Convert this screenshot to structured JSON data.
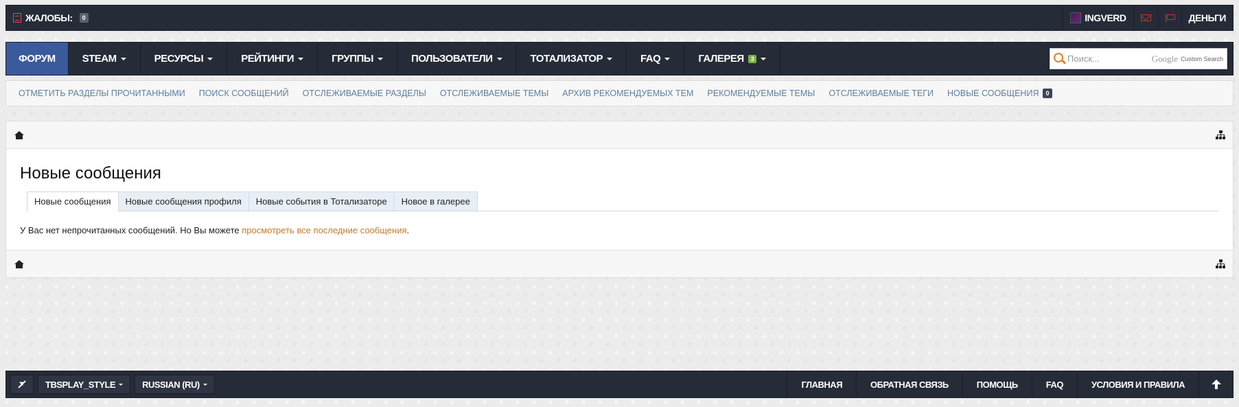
{
  "topbar": {
    "complaints_label": "Жалобы:",
    "complaints_count": "0",
    "username": "Ingverd",
    "money_label": "Деньги",
    "icons": [
      "complaints-icon",
      "avatar",
      "envelope-icon",
      "flag-icon"
    ]
  },
  "mainnav": {
    "tabs": [
      {
        "label": "Форум",
        "active": true,
        "dropdown": false
      },
      {
        "label": "Steam",
        "dropdown": true
      },
      {
        "label": "Ресурсы",
        "dropdown": true
      },
      {
        "label": "Рейтинги",
        "dropdown": true
      },
      {
        "label": "Группы",
        "dropdown": true
      },
      {
        "label": "Пользователи",
        "dropdown": true
      },
      {
        "label": "Тотализатор",
        "dropdown": true
      },
      {
        "label": "FAQ",
        "dropdown": true
      },
      {
        "label": "Галерея",
        "badge": "3",
        "dropdown": true
      }
    ],
    "search": {
      "placeholder": "Поиск...",
      "google_label": "Google",
      "custom_search_label": "Custom Search"
    },
    "active_color": "#3a5a9b",
    "badge_color": "#7cb342"
  },
  "subnav": {
    "links": [
      "Отметить разделы прочитанными",
      "Поиск сообщений",
      "Отслеживаемые разделы",
      "Отслеживаемые темы",
      "Архив рекомендуемых тем",
      "Рекомендуемые темы",
      "Отслеживаемые теги",
      "Новые сообщения"
    ],
    "new_messages_count": "0",
    "link_color": "#5e7f9f"
  },
  "content": {
    "page_title": "Новые сообщения",
    "tabs": [
      "Новые сообщения",
      "Новые сообщения профиля",
      "Новые события в Тотализаторе",
      "Новое в галерее"
    ],
    "message_prefix": "У Вас нет непрочитанных сообщений. Но Вы можете ",
    "message_link": "просмотреть все последние сообщения",
    "message_suffix": ".",
    "link_color": "#c47a2b"
  },
  "footer": {
    "style_chooser": "TBSPlay_Style",
    "language_chooser": "Russian (RU)",
    "links": [
      "Главная",
      "Обратная связь",
      "Помощь",
      "FAQ",
      "Условия и правила"
    ]
  }
}
